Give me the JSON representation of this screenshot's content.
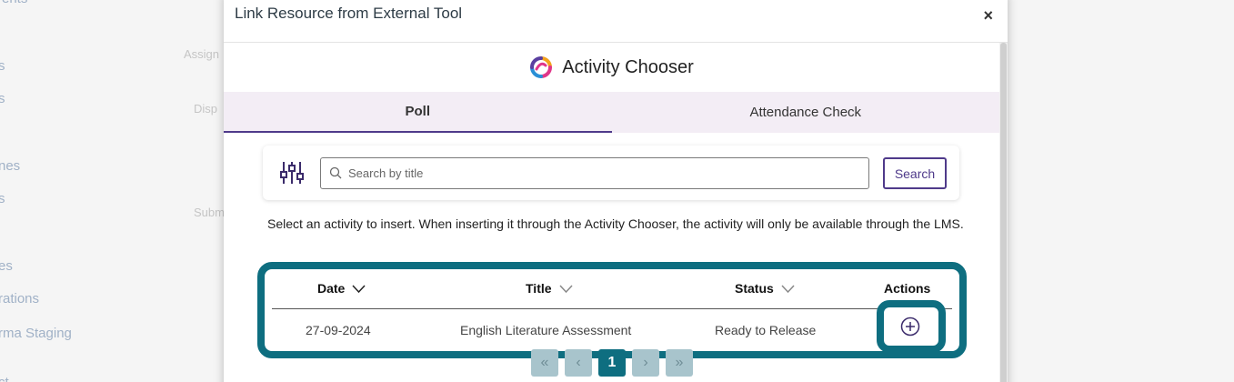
{
  "background": {
    "nav_items": [
      "ents",
      "s",
      "s",
      "nes",
      "s",
      "es",
      "rations",
      "rma Staging",
      "ct"
    ],
    "mid_items": [
      "Assign",
      "Disp",
      "Subm"
    ]
  },
  "modal": {
    "title": "Link Resource from External Tool",
    "close_label": "×"
  },
  "chooser": {
    "title": "Activity Chooser",
    "logo_icon": "activity-chooser-logo",
    "tabs": [
      {
        "label": "Poll",
        "active": true
      },
      {
        "label": "Attendance Check",
        "active": false
      }
    ]
  },
  "search": {
    "placeholder": "Search by title",
    "value": "",
    "button_label": "Search",
    "filter_icon": "sliders-icon"
  },
  "instructions": "Select an activity to insert. When inserting it through the Activity Chooser, the activity will only be available through the LMS.",
  "table": {
    "columns": [
      {
        "label": "Date",
        "sortable": true
      },
      {
        "label": "Title",
        "sortable": true
      },
      {
        "label": "Status",
        "sortable": true
      },
      {
        "label": "Actions",
        "sortable": false
      }
    ],
    "rows": [
      {
        "date": "27-09-2024",
        "title": "English Literature Assessment",
        "status": "Ready to Release",
        "action_icon": "add-circle-icon"
      }
    ]
  },
  "pagination": {
    "first": "«",
    "prev": "‹",
    "current": "1",
    "next": "›",
    "last": "»"
  },
  "colors": {
    "accent": "#4f3a8a",
    "highlight": "#0e6e80",
    "tab_bg": "#f3edf5"
  }
}
